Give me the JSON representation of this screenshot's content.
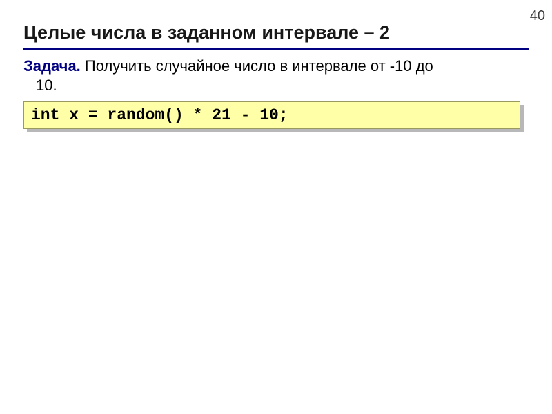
{
  "page_number": "40",
  "title": "Целые числа в заданном интервале – 2",
  "task": {
    "label": "Задача.",
    "text_line1": " Получить случайное число в интервале от -10 до",
    "text_line2": "10."
  },
  "code": "int x = random() * 21 - 10;"
}
